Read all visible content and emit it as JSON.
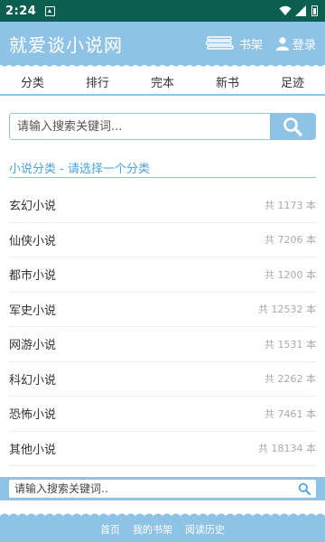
{
  "status_bar": {
    "time": "2:24"
  },
  "header": {
    "site_title": "就爱谈小说网",
    "bookshelf_label": "书架",
    "login_label": "登录"
  },
  "nav": {
    "items": [
      {
        "label": "分类"
      },
      {
        "label": "排行"
      },
      {
        "label": "完本"
      },
      {
        "label": "新书"
      },
      {
        "label": "足迹"
      }
    ]
  },
  "search_top": {
    "placeholder": "请输入搜索关键词..."
  },
  "section": {
    "title": "小说分类 - 请选择一个分类"
  },
  "categories": [
    {
      "name": "玄幻小说",
      "count": "共 1173 本"
    },
    {
      "name": "仙侠小说",
      "count": "共 7206 本"
    },
    {
      "name": "都市小说",
      "count": "共 1200 本"
    },
    {
      "name": "军史小说",
      "count": "共 12532 本"
    },
    {
      "name": "网游小说",
      "count": "共 1531 本"
    },
    {
      "name": "科幻小说",
      "count": "共 2262 本"
    },
    {
      "name": "恐怖小说",
      "count": "共 7461 本"
    },
    {
      "name": "其他小说",
      "count": "共 18134 本"
    }
  ],
  "search_bottom": {
    "placeholder": "请输入搜索关键词.."
  },
  "footer": {
    "links": [
      {
        "label": "首页"
      },
      {
        "label": "我的书架"
      },
      {
        "label": "阅读历史"
      }
    ]
  },
  "colors": {
    "status_bar": "#0b5f50",
    "brand": "#8fc3e6",
    "section_title": "#4da3db"
  }
}
